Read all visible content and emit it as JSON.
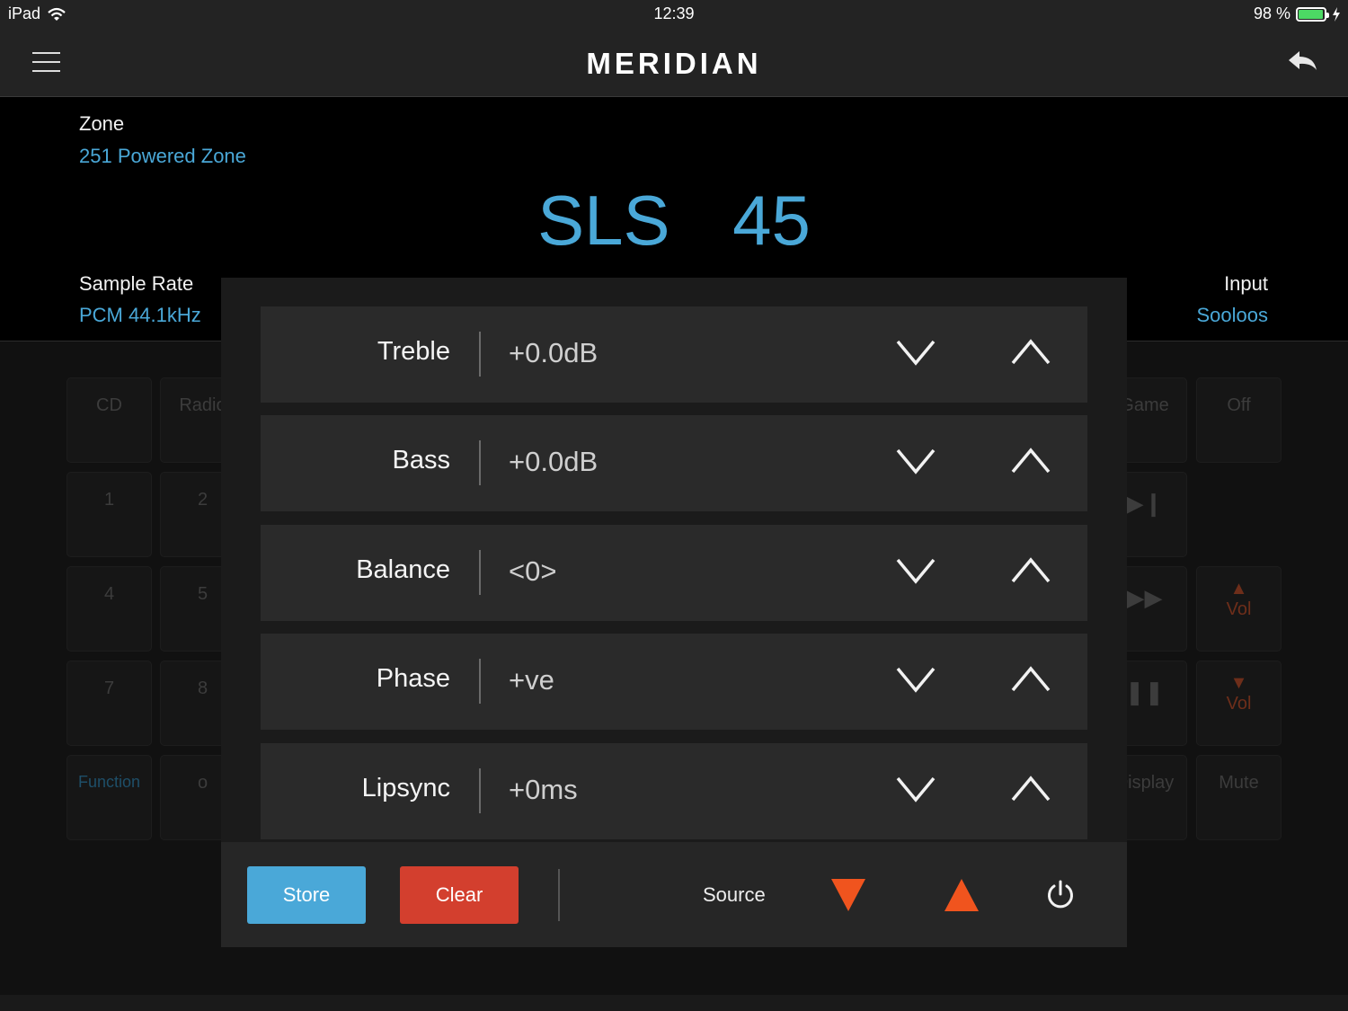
{
  "status_bar": {
    "device": "iPad",
    "time": "12:39",
    "battery": "98 %",
    "battery_level": 0.98
  },
  "header": {
    "logo": "MERIDIAN",
    "menu_icon": "hamburger-icon",
    "back_icon": "back-arrow-icon"
  },
  "info": {
    "zone_label": "Zone",
    "zone_value": "251 Powered Zone",
    "device_name": "SLS",
    "volume": "45",
    "sample_rate_label": "Sample Rate",
    "sample_rate_value": "PCM 44.1kHz",
    "input_label": "Input",
    "input_value": "Sooloos"
  },
  "keypad": {
    "cd": "CD",
    "radio": "Radio",
    "game": "Game",
    "off": "Off",
    "k1": "1",
    "k2": "2",
    "k4": "4",
    "k5": "5",
    "k7": "7",
    "k8": "8",
    "function": "Function",
    "k0": "o",
    "display": "Display",
    "mute": "Mute",
    "vol_up": "Vol",
    "vol_down": "Vol"
  },
  "settings": [
    {
      "label": "Treble",
      "value": "+0.0dB"
    },
    {
      "label": "Bass",
      "value": "+0.0dB"
    },
    {
      "label": "Balance",
      "value": "<0>"
    },
    {
      "label": "Phase",
      "value": "+ve"
    },
    {
      "label": "Lipsync",
      "value": "+0ms"
    }
  ],
  "actions": {
    "store": "Store",
    "clear": "Clear",
    "source": "Source"
  },
  "colors": {
    "accent": "#4aa8d8",
    "clear": "#d33f2e",
    "source_arrow": "#f0541e",
    "background": "#000000"
  }
}
